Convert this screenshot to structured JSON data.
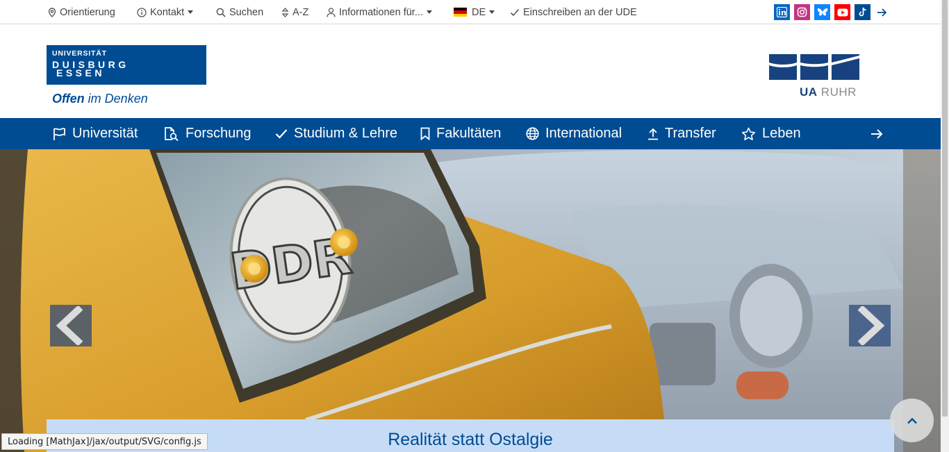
{
  "topbar": {
    "orientation": "Orientierung",
    "contact": "Kontakt",
    "search": "Suchen",
    "az": "A-Z",
    "info_for": "Informationen für...",
    "language": "DE",
    "enroll": "Einschreiben an der UDE"
  },
  "social": {
    "linkedin": {
      "icon": "linkedin-icon",
      "color": "#0a66c2"
    },
    "instagram": {
      "icon": "instagram-icon",
      "color": "#c13584"
    },
    "bluesky": {
      "icon": "bluesky-icon",
      "color": "#1185fe"
    },
    "youtube": {
      "icon": "youtube-icon",
      "color": "#ff0000"
    },
    "tiktok": {
      "icon": "tiktok-icon",
      "color": "#004c93"
    }
  },
  "logo": {
    "line1": "UNIVERSITÄT",
    "line2": "DUISBURG",
    "line3": "ESSEN",
    "slogan_bold": "Offen",
    "slogan_rest": " im Denken",
    "partner_ua": "UA",
    "partner_ruhr": "RUHR"
  },
  "nav": {
    "university": "Universität",
    "research": "Forschung",
    "studies": "Studium & Lehre",
    "faculties": "Fakultäten",
    "international": "International",
    "transfer": "Transfer",
    "life": "Leben"
  },
  "hero": {
    "sign_text": "DDR",
    "caption_title": "Realität statt Ostalgie"
  },
  "status_bar": "Loading [MathJax]/jax/output/SVG/config.js",
  "colors": {
    "brand": "#004c93",
    "caption_bg": "#c6dcf6"
  }
}
